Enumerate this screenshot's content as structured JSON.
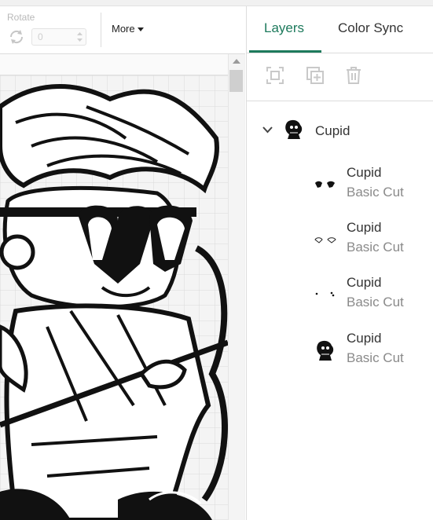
{
  "toolbar": {
    "rotate_label": "Rotate",
    "rotate_value": "0",
    "more_label": "More"
  },
  "tabs": {
    "layers": "Layers",
    "color_sync": "Color Sync"
  },
  "layer_tools": [
    "group-icon",
    "duplicate-icon",
    "delete-icon"
  ],
  "group": {
    "name": "Cupid",
    "expanded": true
  },
  "layers": [
    {
      "name": "Cupid",
      "type": "Basic Cut"
    },
    {
      "name": "Cupid",
      "type": "Basic Cut"
    },
    {
      "name": "Cupid",
      "type": "Basic Cut"
    },
    {
      "name": "Cupid",
      "type": "Basic Cut"
    }
  ],
  "colors": {
    "accent": "#1d7a5c",
    "canvas_bg": "#f1f1f1",
    "art": "#111111"
  }
}
